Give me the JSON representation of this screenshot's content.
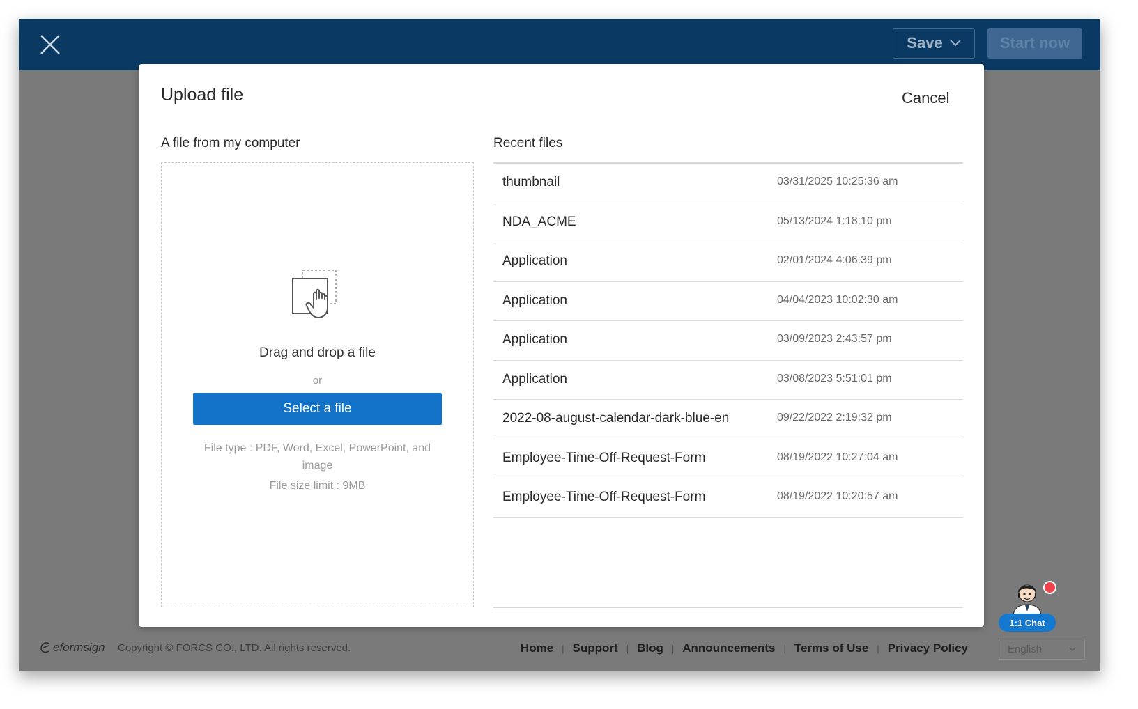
{
  "topbar": {
    "save_label": "Save",
    "start_label": "Start now",
    "background": "#0a3a63"
  },
  "modal": {
    "title": "Upload file",
    "cancel_label": "Cancel",
    "left": {
      "heading": "A file from my computer",
      "drag_text": "Drag and drop a file",
      "or_text": "or",
      "select_label": "Select a file",
      "file_type_text": "File type : PDF, Word, Excel, PowerPoint, and image",
      "file_size_text": "File size limit : 9MB",
      "icon": "drag-drop-hand-icon"
    },
    "right": {
      "heading": "Recent files",
      "files": [
        {
          "name": "thumbnail",
          "date": "03/31/2025 10:25:36 am"
        },
        {
          "name": "NDA_ACME",
          "date": "05/13/2024 1:18:10 pm"
        },
        {
          "name": "Application",
          "date": "02/01/2024 4:06:39 pm"
        },
        {
          "name": "Application",
          "date": "04/04/2023 10:02:30 am"
        },
        {
          "name": "Application",
          "date": "03/09/2023 2:43:57 pm"
        },
        {
          "name": "Application",
          "date": "03/08/2023 5:51:01 pm"
        },
        {
          "name": "2022-08-august-calendar-dark-blue-en",
          "date": "09/22/2022 2:19:32 pm"
        },
        {
          "name": "Employee-Time-Off-Request-Form",
          "date": "08/19/2022 10:27:04 am"
        },
        {
          "name": "Employee-Time-Off-Request-Form",
          "date": "08/19/2022 10:20:57 am"
        }
      ]
    },
    "accent": "#1172c8"
  },
  "footer": {
    "logo_text": "eformsign",
    "copyright": "Copyright © FORCS CO., LTD. All rights reserved.",
    "links": [
      "Home",
      "Support",
      "Blog",
      "Announcements",
      "Terms of Use",
      "Privacy Policy"
    ],
    "language": "English"
  },
  "chat": {
    "label": "1:1 Chat"
  }
}
